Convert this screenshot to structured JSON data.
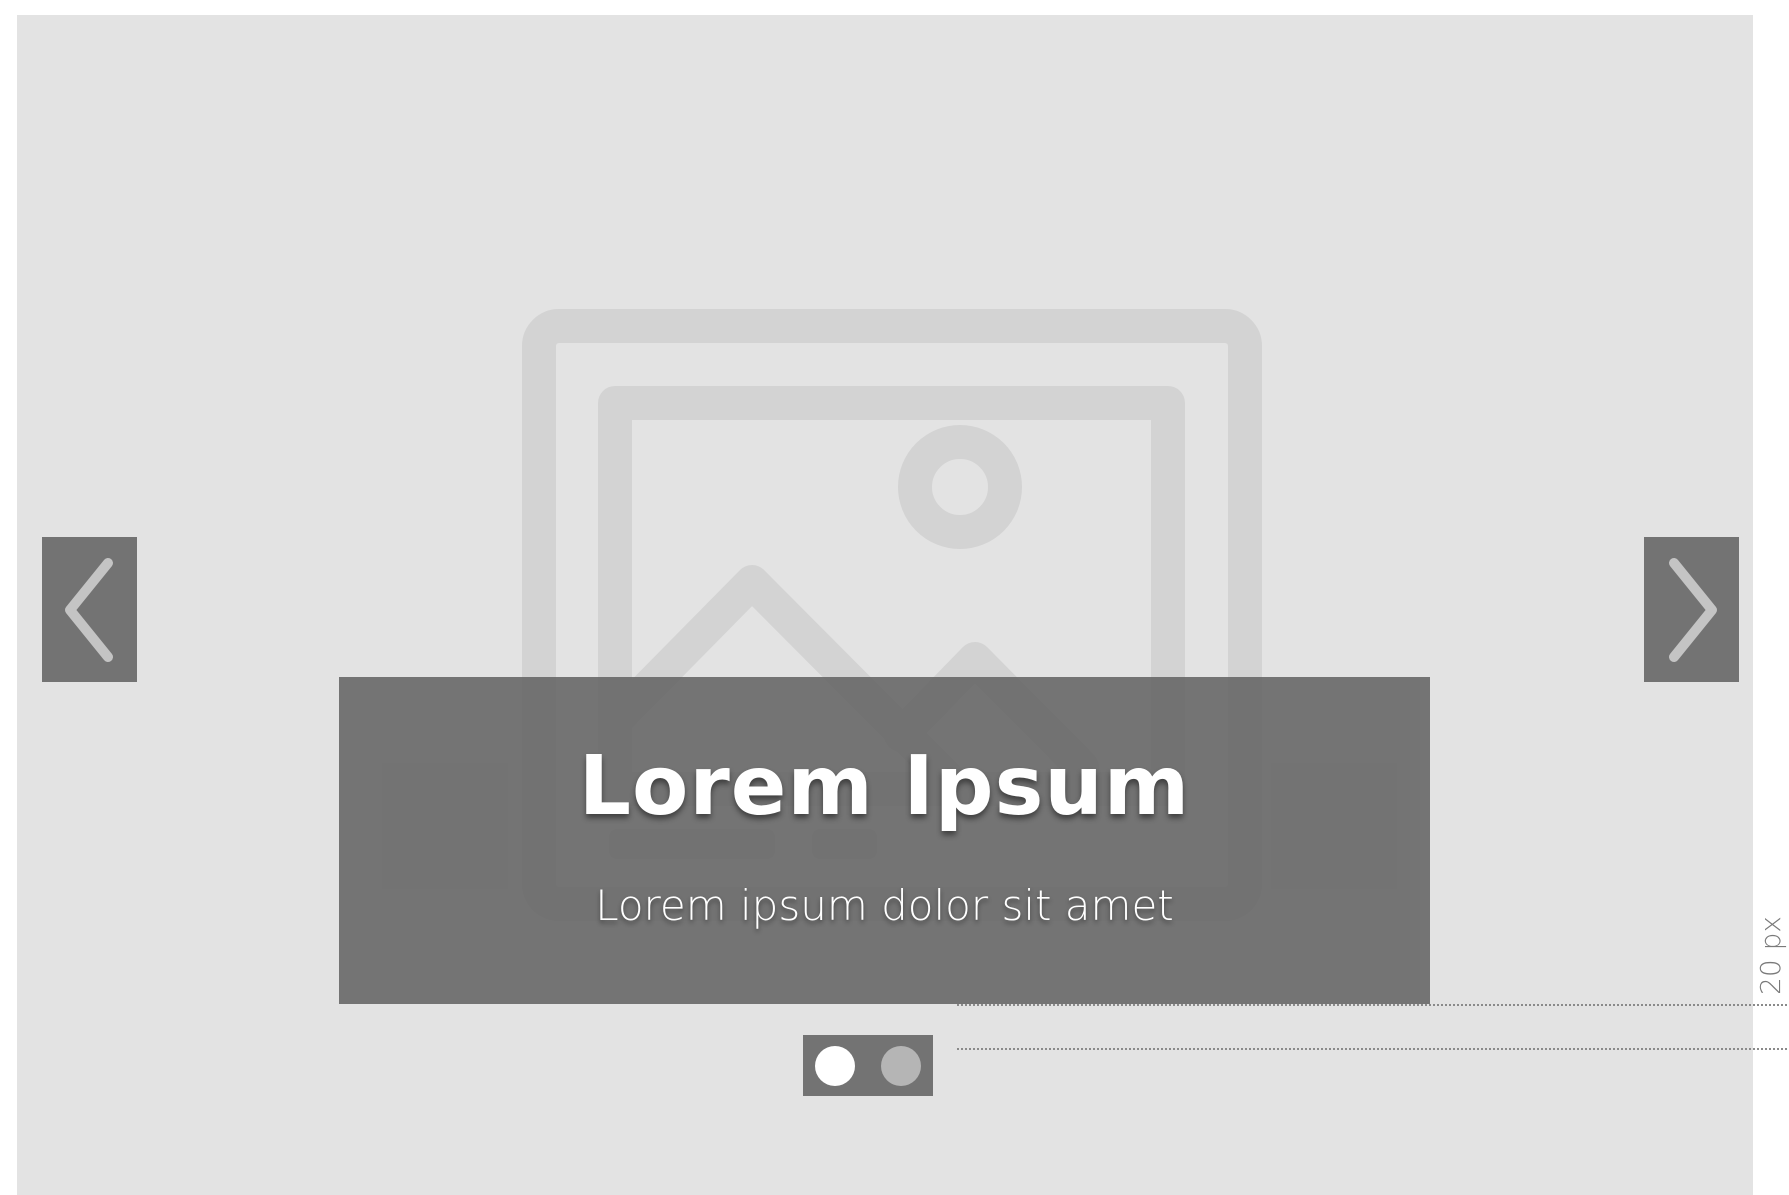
{
  "carousel": {
    "caption_title": "Lorem Ipsum",
    "caption_subtitle": "Lorem ipsum dolor sit amet",
    "prev_icon": "chevron-left-icon",
    "next_icon": "chevron-right-icon",
    "image_icon": "image-placeholder-icon",
    "slides_total": 2,
    "active_slide": 1
  },
  "annotation": {
    "spacing_label": "20 px"
  },
  "colors": {
    "slide_bg": "#e3e3e3",
    "overlay": "#737373",
    "icon": "#d3d3d3",
    "dot_active": "#ffffff",
    "dot_inactive": "#b5b5b5"
  }
}
